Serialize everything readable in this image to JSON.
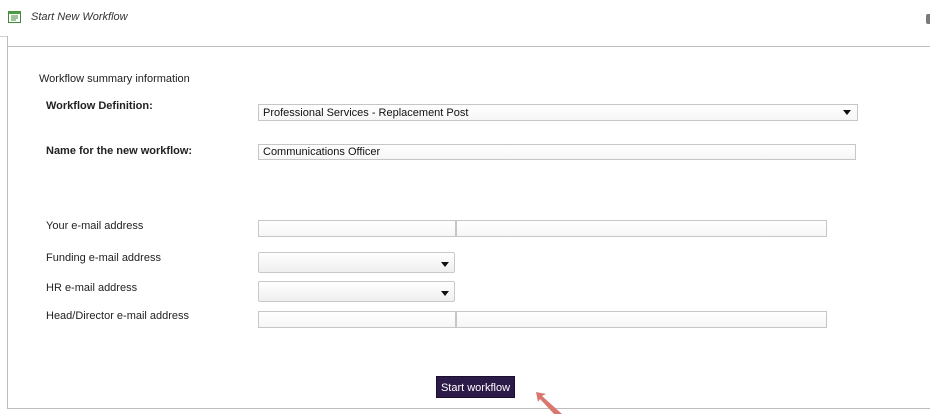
{
  "window": {
    "title": "Start New Workflow"
  },
  "form": {
    "section_heading": "Workflow summary information",
    "workflow_definition": {
      "label": "Workflow Definition:",
      "value": "Professional Services - Replacement Post"
    },
    "workflow_name": {
      "label": "Name for the new workflow:",
      "value": "Communications Officer"
    },
    "your_email": {
      "label": "Your e-mail address",
      "value_left": "",
      "value_right": ""
    },
    "funding_email": {
      "label": "Funding e-mail address",
      "value": ""
    },
    "hr_email": {
      "label": "HR e-mail address",
      "value": ""
    },
    "head_email": {
      "label": "Head/Director e-mail address",
      "value_left": "",
      "value_right": ""
    },
    "start_button": "Start workflow"
  },
  "colors": {
    "button_bg": "#2c1a48",
    "pointer": "#d9776f"
  }
}
